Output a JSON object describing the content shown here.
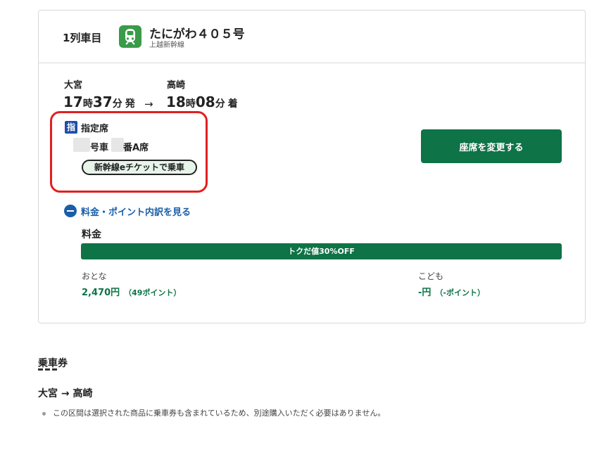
{
  "train": {
    "car_label": "1列車目",
    "icon": "train-icon",
    "name": "たにがわ４０５号",
    "line": "上越新幹線"
  },
  "departure": {
    "station": "大宮",
    "hour": "17",
    "hour_unit": "時",
    "minute": "37",
    "minute_unit": "分",
    "suffix": "発"
  },
  "arrow": "→",
  "arrival": {
    "station": "高崎",
    "hour": "18",
    "hour_unit": "時",
    "minute": "08",
    "minute_unit": "分",
    "suffix": "着"
  },
  "seat": {
    "badge": "指",
    "type": "指定席",
    "car_suffix": "号車",
    "seat_suffix": "番A席",
    "eticket": "新幹線eチケットで乗車"
  },
  "change_button": "座席を変更する",
  "breakdown_link": "料金・ポイント内訳を見る",
  "fare": {
    "label": "料金",
    "discount": "トクだ値30%OFF",
    "adult_label": "おとな",
    "adult_price": "2,470円",
    "adult_points": "（49ポイント）",
    "child_label": "こども",
    "child_price": "-円",
    "child_points": "（-ポイント）"
  },
  "ticket": {
    "title": "乗車券",
    "route": "大宮 → 高崎",
    "note": "この区間は選択された商品に乗車券も含まれているため、別途購入いただく必要はありません。"
  },
  "colors": {
    "primary_green": "#0e7346",
    "train_icon_green": "#3a9b48",
    "link_blue": "#1a5ea8",
    "badge_blue": "#1f4fa8",
    "highlight_red": "#e02020"
  }
}
